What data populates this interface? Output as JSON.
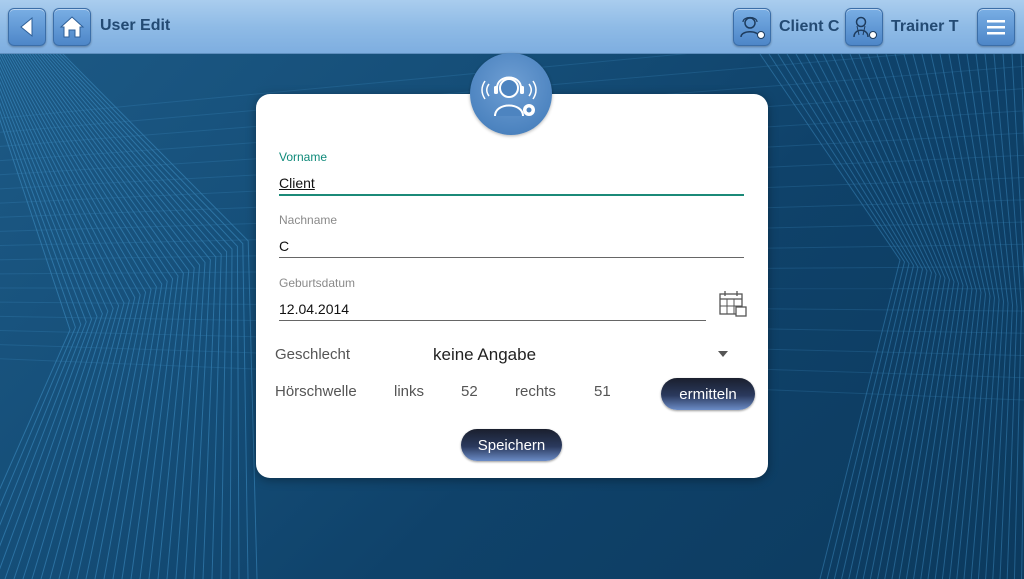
{
  "topbar": {
    "title": "User Edit",
    "client_label": "Client C",
    "trainer_label": "Trainer T",
    "icons": {
      "back": "back-arrow-icon",
      "home": "home-icon",
      "client": "client-settings-icon",
      "trainer": "trainer-settings-icon",
      "menu": "hamburger-menu-icon"
    }
  },
  "form": {
    "first_name": {
      "label": "Vorname",
      "value": "Client"
    },
    "last_name": {
      "label": "Nachname",
      "value": "C"
    },
    "birthdate": {
      "label": "Geburtsdatum",
      "value": "12.04.2014"
    },
    "gender": {
      "label": "Geschlecht",
      "selected": "keine Angabe"
    },
    "hearing_threshold": {
      "label": "Hörschwelle",
      "left_label": "links",
      "left_value": "52",
      "right_label": "rechts",
      "right_value": "51",
      "determine_button": "ermitteln"
    },
    "save_button": "Speichern"
  },
  "colors": {
    "accent": "#1b8a78",
    "topbar": "#8fbbe6",
    "background": "#154e78",
    "button_dark": "#1a1f2e"
  }
}
